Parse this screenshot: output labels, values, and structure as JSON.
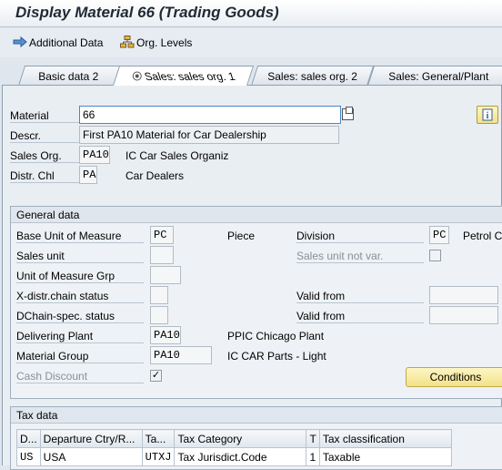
{
  "window": {
    "title": "Display Material 66 (Trading Goods)"
  },
  "toolbar": {
    "additional_data": "Additional Data",
    "org_levels": "Org. Levels"
  },
  "tabs": [
    {
      "label": "Basic data 2",
      "active": false
    },
    {
      "label": "Sales: sales org. 1",
      "active": true
    },
    {
      "label": "Sales: sales org. 2",
      "active": false
    },
    {
      "label": "Sales: General/Plant",
      "active": false
    }
  ],
  "header": {
    "material_label": "Material",
    "material_value": "66",
    "descr_label": "Descr.",
    "descr_value": "First PA10 Material for Car Dealership",
    "sales_org_label": "Sales Org.",
    "sales_org_value": "PA10",
    "sales_org_text": "IC Car Sales Organiz",
    "distr_chl_label": "Distr. Chl",
    "distr_chl_value": "PA",
    "distr_chl_text": "Car Dealers"
  },
  "general": {
    "title": "General data",
    "base_uom_label": "Base Unit of Measure",
    "base_uom_value": "PC",
    "base_uom_text": "Piece",
    "division_label": "Division",
    "division_value": "PC",
    "division_text": "Petrol C",
    "sales_unit_label": "Sales unit",
    "sales_unit_value": "",
    "sales_unit_not_var_label": "Sales unit not var.",
    "uom_grp_label": "Unit of Measure Grp",
    "uom_grp_value": "",
    "xdistr_label": "X-distr.chain status",
    "xdistr_value": "",
    "valid_from_label_1": "Valid from",
    "valid_from_value_1": "",
    "dchain_label": "DChain-spec. status",
    "dchain_value": "",
    "valid_from_label_2": "Valid from",
    "valid_from_value_2": "",
    "deliv_plant_label": "Delivering Plant",
    "deliv_plant_value": "PA10",
    "deliv_plant_text": "PPIC Chicago Plant",
    "mat_group_label": "Material Group",
    "mat_group_value": "PA10",
    "mat_group_text": "IC CAR Parts - Light",
    "cash_discount_label": "Cash Discount",
    "cash_discount_checked": true,
    "conditions_label": "Conditions"
  },
  "tax": {
    "title": "Tax data",
    "columns": [
      "D...",
      "Departure Ctry/R...",
      "Ta...",
      "Tax Category",
      "T",
      "Tax classification"
    ],
    "rows": [
      [
        "US",
        "USA",
        "UTXJ",
        "Tax Jurisdict.Code",
        "1",
        "Taxable"
      ]
    ]
  }
}
